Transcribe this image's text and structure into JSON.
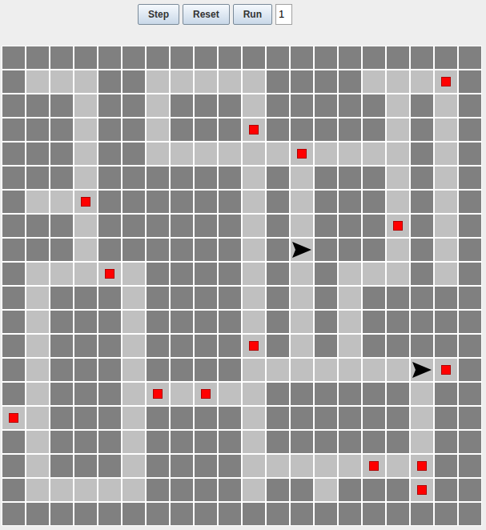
{
  "toolbar": {
    "buttons": [
      "Step",
      "Reset",
      "Run"
    ],
    "field": {
      "value": "1"
    }
  },
  "grid": {
    "legend": {
      "#": "wall",
      ".": "floor",
      "*": "item",
      ">": "agent-right"
    },
    "rows": [
      "####################",
      "#...##.....####...*#",
      "###.##.###.#####.#.#",
      "###.##.###*#####.#.#",
      "###.##......*....#.#",
      "###.######.#.###.#.#",
      "#..*######.#.###.#.#",
      "###.######.#.###*#.#",
      "###.######.#>###.#.#",
      "#...*.####.#.#...#.#",
      "#.###.####.#.#.#####",
      "#.###.####.#.#.#####",
      "#.###.####*#.#.#####",
      "#.###.####.......>*#",
      "#.###.*.*..######.##",
      "*.###.####.######.##",
      "#.###.####.######.##",
      "#.###.####.....*.*##",
      "#.....####.##.###*##",
      "####################"
    ]
  }
}
